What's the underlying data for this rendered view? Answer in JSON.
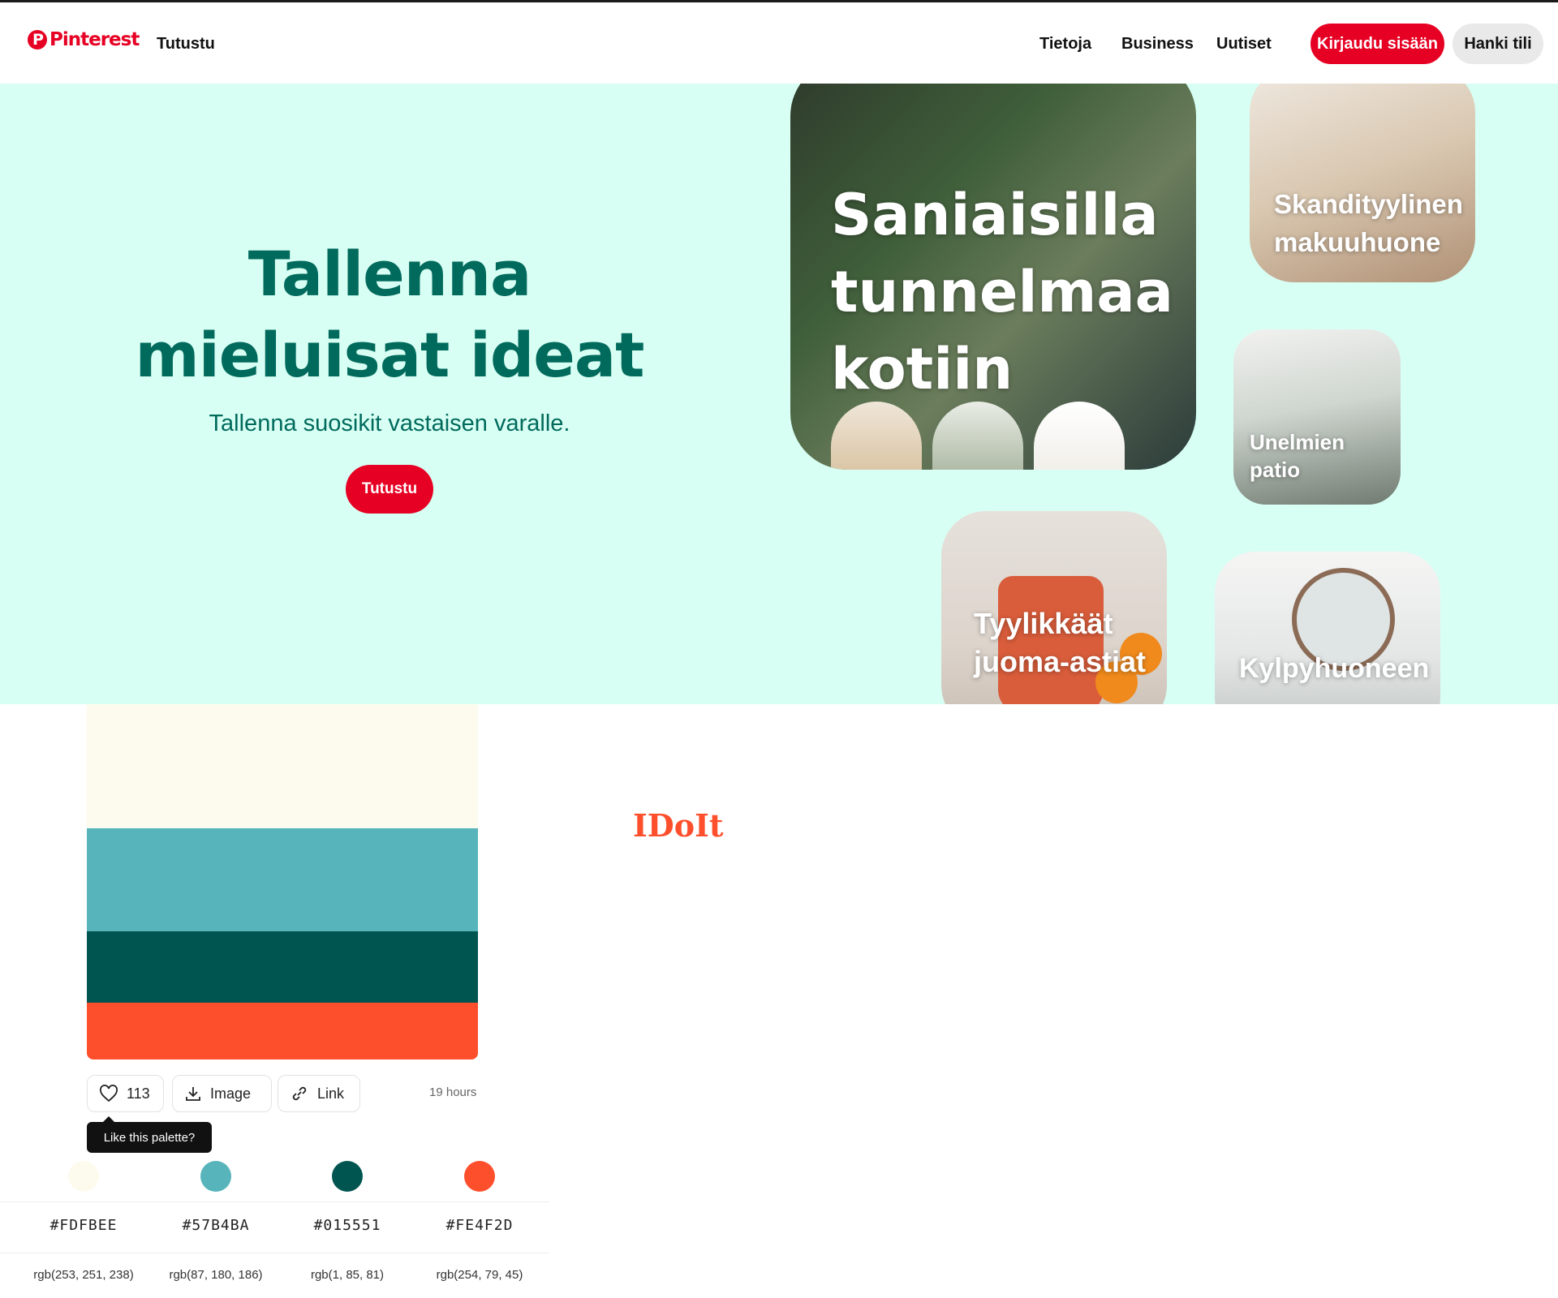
{
  "header": {
    "logo_text": "Pinterest",
    "explore_label": "Tutustu",
    "nav": [
      "Tietoja",
      "Business",
      "Uutiset"
    ],
    "login_label": "Kirjaudu sisään",
    "signup_label": "Hanki tili",
    "brand_color": "#e60023"
  },
  "hero": {
    "title": "Tallenna mieluisat ideat",
    "subtitle": "Tallenna suosikit vastaisen varalle.",
    "button_label": "Tutustu",
    "background": "#d8fff4",
    "cards": [
      {
        "label": "Saniaisilla tunnelmaa kotiin"
      },
      {
        "label": "Skandityylinen makuuhuone"
      },
      {
        "label": "Unelmien patio"
      },
      {
        "label": "Tyylikkäät juoma-astiat"
      },
      {
        "label": "Kylpyhuoneen"
      }
    ]
  },
  "palette": {
    "brand_text": "IDoIt",
    "likes": "113",
    "image_label": "Image",
    "link_label": "Link",
    "time": "19 hours",
    "tooltip": "Like this palette?",
    "colors": [
      {
        "hex": "#FDFBEE",
        "rgb": "rgb(253, 251, 238)",
        "share": 0.35
      },
      {
        "hex": "#57B4BA",
        "rgb": "rgb(87, 180, 186)",
        "share": 0.29
      },
      {
        "hex": "#015551",
        "rgb": "rgb(1, 85, 81)",
        "share": 0.2
      },
      {
        "hex": "#FE4F2D",
        "rgb": "rgb(254, 79, 45)",
        "share": 0.16
      }
    ]
  }
}
